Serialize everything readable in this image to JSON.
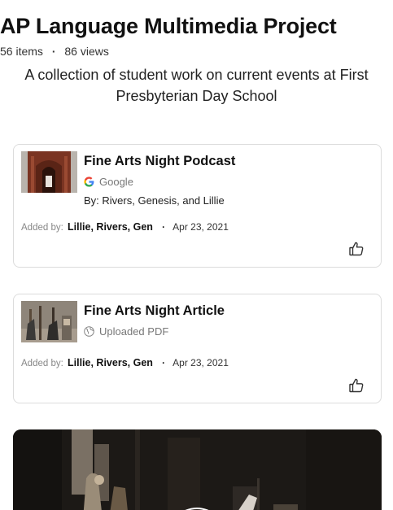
{
  "header": {
    "title": "AP Language Multimedia Project",
    "items_count": "56 items",
    "views_count": "86 views",
    "description": "A collection of student work on current events at First Presbyterian Day School"
  },
  "cards": [
    {
      "title": "Fine Arts Night Podcast",
      "source": "Google",
      "source_icon": "google-icon",
      "byline": "By: Rivers, Genesis, and Lillie",
      "added_label": "Added by:",
      "added_by": "Lillie, Rivers, Gen",
      "date": "Apr 23, 2021"
    },
    {
      "title": "Fine Arts Night Article",
      "source": "Uploaded PDF",
      "source_icon": "globe-icon",
      "added_label": "Added by:",
      "added_by": "Lillie, Rivers, Gen",
      "date": "Apr 23, 2021"
    }
  ]
}
